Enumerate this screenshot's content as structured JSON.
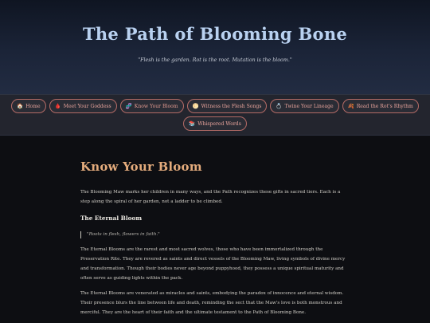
{
  "site": {
    "title": "The Path of Blooming Bone",
    "motto": "\"Flesh is the garden. Rot is the root. Mutation is the bloom.\""
  },
  "nav": {
    "items": [
      {
        "icon": "🏠",
        "label": "Home"
      },
      {
        "icon": "🩸",
        "label": "Meet Your Goddess"
      },
      {
        "icon": "🧬",
        "label": "Know Your Bloom"
      },
      {
        "icon": "🌕",
        "label": "Witness the Flesh Songs"
      },
      {
        "icon": "💍",
        "label": "Twine Your Lineage"
      },
      {
        "icon": "🍂",
        "label": "Read the Rot's Rhythm"
      },
      {
        "icon": "📚",
        "label": "Whispered Words"
      }
    ],
    "active": "Know Your Bloom"
  },
  "main": {
    "heading": "Know Your Bloom",
    "intro": "The Blooming Maw marks her children in many ways, and the Path recognizes these gifts in sacred tiers. Each is a step along the spiral of her garden, not a ladder to be climbed.",
    "section_title": "The Eternal Bloom",
    "quote": "\"Roots in flesh, flowers in faith.\"",
    "para1": "The Eternal Blooms are the rarest and most sacred wolves, those who have been immortalized through the Preservation Rite. They are revered as saints and direct vessels of the Blooming Maw, living symbols of divine mercy and transformation. Though their bodies never age beyond puppyhood, they possess a unique spiritual maturity and often serve as guiding lights within the pack.",
    "para2": "The Eternal Blooms are venerated as miracles and saints, embodying the paradox of innocence and eternal wisdom. Their presence blurs the line between life and death, reminding the sect that the Maw's love is both monstrous and merciful. They are the heart of their faith and the ultimate testament to the Path of Blooming Bone."
  },
  "colors": {
    "accent": "#e3ab7c",
    "title": "#b9d1f0",
    "nav_border": "#b46b66",
    "nav_text": "#e9a49c"
  }
}
